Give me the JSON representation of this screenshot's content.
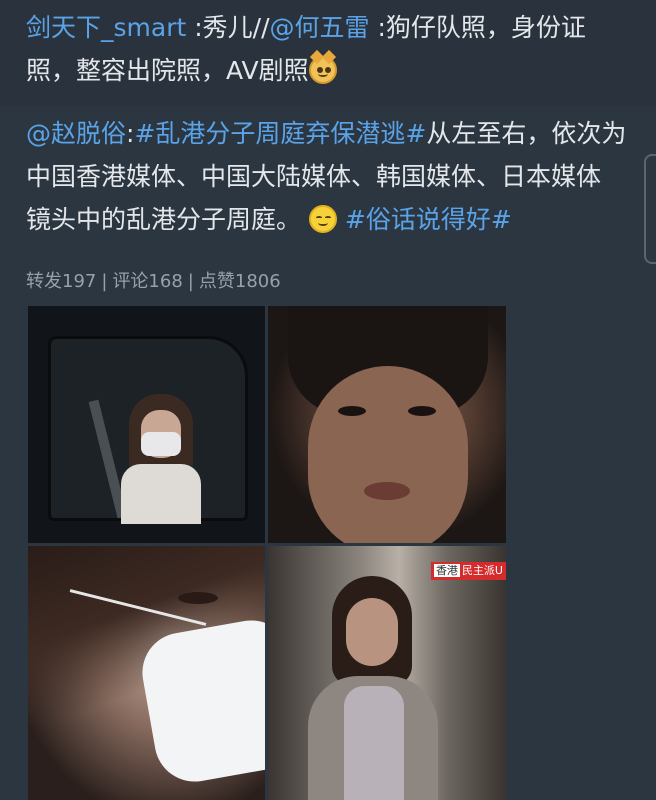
{
  "repost": {
    "author": "剑天下_smart",
    "sep1": " :秀儿//",
    "mention": "@何五雷",
    "text": " :狗仔队照，身份证照，整容出院照，AV剧照",
    "emoji": "doge-emoji"
  },
  "post": {
    "author": "@赵脱俗",
    "sep": ":",
    "topic": "#乱港分子周庭弃保潜逃#",
    "text": "从左至右，依次为中国香港媒体、中国大陆媒体、韩国媒体、日本媒体 镜头中的乱港分子周庭。",
    "emoji": "smile-emoji",
    "hashtag": "#俗话说得好#"
  },
  "stats": {
    "reposts": "转发197",
    "comments": "评论168",
    "likes": "点赞1806",
    "separator": "|"
  },
  "photos": {
    "caption_station": "香港",
    "caption_text": "民主派U"
  },
  "colors": {
    "background": "#2c3640",
    "link": "#5aa3e8",
    "text": "#e4e7ea",
    "muted": "#98a1aa"
  }
}
